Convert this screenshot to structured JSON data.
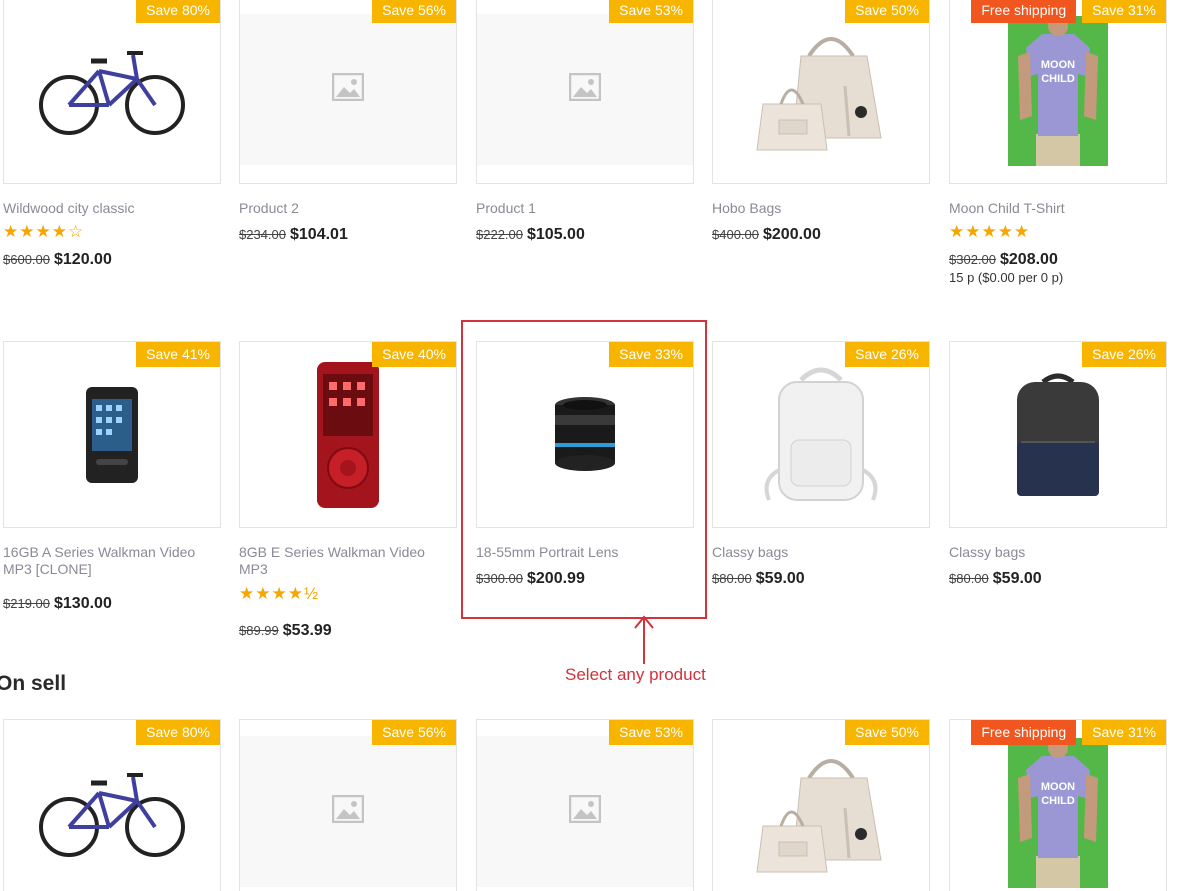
{
  "row1": [
    {
      "title": "Wildwood city classic",
      "stars": "★★★★☆",
      "old": "$600.00",
      "new": "$120.00",
      "badges": [
        "Save 80%"
      ],
      "image": "bicycle"
    },
    {
      "title": "Product 2",
      "stars": "",
      "old": "$234.00",
      "new": "$104.01",
      "badges": [
        "Save 56%"
      ],
      "image": "placeholder"
    },
    {
      "title": "Product 1",
      "stars": "",
      "old": "$222.00",
      "new": "$105.00",
      "badges": [
        "Save 53%"
      ],
      "image": "placeholder"
    },
    {
      "title": "Hobo Bags",
      "stars": "",
      "old": "$400.00",
      "new": "$200.00",
      "badges": [
        "Save 50%"
      ],
      "image": "handbag"
    },
    {
      "title": "Moon Child T-Shirt",
      "stars": "★★★★★",
      "old": "$302.00",
      "new": "$208.00",
      "unit": "15 p ($0.00 per 0 p)",
      "badges": [
        "Free shipping",
        "Save 31%"
      ],
      "image": "tshirt"
    }
  ],
  "row2": [
    {
      "title": "16GB A Series Walkman Video MP3 [CLONE]",
      "stars": "",
      "old": "$219.00",
      "new": "$130.00",
      "badges": [
        "Save 41%"
      ],
      "image": "mp3-black"
    },
    {
      "title": "8GB E Series Walkman Video MP3",
      "stars": "★★★★½",
      "old": "$89.99",
      "new": "$53.99",
      "badges": [
        "Save 40%"
      ],
      "image": "mp3-red"
    },
    {
      "title": "18-55mm Portrait Lens",
      "stars": "",
      "old": "$300.00",
      "new": "$200.99",
      "badges": [
        "Save 33%"
      ],
      "image": "lens"
    },
    {
      "title": "Classy bags",
      "stars": "",
      "old": "$80.00",
      "new": "$59.00",
      "badges": [
        "Save 26%"
      ],
      "image": "backpack-white"
    },
    {
      "title": "Classy bags",
      "stars": "",
      "old": "$80.00",
      "new": "$59.00",
      "badges": [
        "Save 26%"
      ],
      "image": "backpack-dark"
    }
  ],
  "section": {
    "title": "On sell"
  },
  "row3": [
    {
      "badges": [
        "Save 80%"
      ],
      "image": "bicycle"
    },
    {
      "badges": [
        "Save 56%"
      ],
      "image": "placeholder"
    },
    {
      "badges": [
        "Save 53%"
      ],
      "image": "placeholder"
    },
    {
      "badges": [
        "Save 50%"
      ],
      "image": "handbag"
    },
    {
      "badges": [
        "Free shipping",
        "Save 31%"
      ],
      "image": "tshirt"
    }
  ],
  "annotation": {
    "text": "Select any product"
  },
  "colors": {
    "save_badge": "#f7b500",
    "shipping_badge": "#f0561d",
    "annotation": "#d23239",
    "star": "#f7a500"
  }
}
